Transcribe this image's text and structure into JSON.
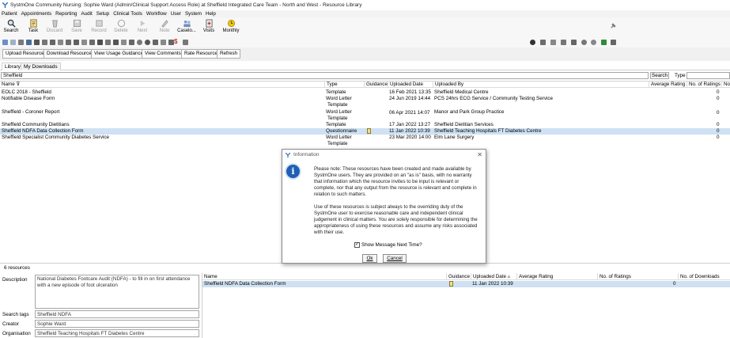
{
  "window": {
    "title": "SystmOne Community Nursing: Sophie Ward (Admin/Clinical Support Access Role) at Sheffield Integrated Care Team - North and West - Resource Library"
  },
  "menu": [
    "Patient",
    "Appointments",
    "Reporting",
    "Audit",
    "Setup",
    "Clinical Tools",
    "Workflow",
    "User",
    "System",
    "Help"
  ],
  "toolbar": [
    {
      "label": "Search",
      "icon": "search-icon",
      "enabled": true
    },
    {
      "label": "Task",
      "icon": "task-icon",
      "enabled": true
    },
    {
      "label": "Discard",
      "icon": "discard-icon",
      "enabled": false
    },
    {
      "label": "Save",
      "icon": "save-icon",
      "enabled": false
    },
    {
      "label": "Record",
      "icon": "record-icon",
      "enabled": false
    },
    {
      "label": "Delete",
      "icon": "delete-icon",
      "enabled": false
    },
    {
      "label": "Next",
      "icon": "next-icon",
      "enabled": false
    },
    {
      "label": "Note",
      "icon": "note-icon",
      "enabled": false
    },
    {
      "label": "Caselo...",
      "icon": "caseload-icon",
      "enabled": true
    },
    {
      "label": "Visits",
      "icon": "visits-icon",
      "enabled": true
    },
    {
      "label": "Monthly",
      "icon": "monthly-icon",
      "enabled": true
    }
  ],
  "actions": {
    "upload": "Upload Resource",
    "download": "Download Resource",
    "usage": "View Usage Guidance",
    "comments": "View Comments",
    "rate": "Rate Resource",
    "refresh": "Refresh"
  },
  "tabs": [
    "Library",
    "My Downloads"
  ],
  "search": {
    "value": "Sheffield",
    "button": "Search",
    "type_label": "Type"
  },
  "grid": {
    "columns": [
      "Name",
      "Type",
      "Guidance",
      "Uploaded Date",
      "Uploaded By",
      "Average Rating",
      "No. of Ratings",
      "No"
    ],
    "rows": [
      {
        "name": "EOLC 2018 - Sheffield",
        "type": "Template",
        "type2": "",
        "guidance": false,
        "date": "16 Feb 2021 13:35",
        "by": "Sheffield Medical Centre",
        "ratings": "0",
        "selected": false
      },
      {
        "name": "Notifiable Disease Form",
        "type": "Word Letter",
        "type2": "Template",
        "guidance": false,
        "date": "24 Jun 2019 14:44",
        "by": "PCS 24hrs ECG Service / Community Testing Service",
        "ratings": "0",
        "selected": false
      },
      {
        "name": "Sheffield - Coroner Report",
        "type": "Word Letter",
        "type2": "Template",
        "guidance": false,
        "date": "06 Apr 2021 14:07",
        "by": "Manor and Park Group Practice",
        "ratings": "0",
        "selected": false
      },
      {
        "name": "Sheffield Community Dietitians",
        "type": "Template",
        "type2": "",
        "guidance": false,
        "date": "17 Jan 2022 13:27",
        "by": "Sheffield Dietitian Services",
        "ratings": "0",
        "selected": false
      },
      {
        "name": "Sheffield NDFA Data Collection Form",
        "type": "Questionnaire",
        "type2": "",
        "guidance": true,
        "date": "11 Jan 2022 10:39",
        "by": "Sheffield Teaching Hospitals FT Diabetes Centre",
        "ratings": "0",
        "selected": true
      },
      {
        "name": "Sheffield Specialist Community Diabetes Service",
        "type": "Word Letter",
        "type2": "Template",
        "guidance": false,
        "date": "23 Mar 2020 14:00",
        "by": "Elm Lane Surgery",
        "ratings": "0",
        "selected": false
      }
    ]
  },
  "details": {
    "count": "6 resources",
    "description_label": "Description",
    "description": "National Diabetes Footcare Audit (NDFA) - to fill in on first attendance with a new episode of foot ulceration",
    "tags_label": "Search tags",
    "tags": "Sheffield NDFA",
    "creator_label": "Creator",
    "creator": "Sophie Ward",
    "org_label": "Organisation",
    "org": "Sheffield Teaching Hospitals FT Diabetes Centre"
  },
  "detail_grid": {
    "columns": [
      "Name",
      "Guidance",
      "Uploaded Date",
      "Average Rating",
      "No. of Ratings",
      "No. of Downloads"
    ],
    "row": {
      "name": "Sheffield NDFA Data Collection Form",
      "date": "11 Jan 2022 10:39",
      "ratings": "0"
    }
  },
  "dialog": {
    "title": "Information",
    "para1": "Please note: These resources have been created and made available by SystmOne users. They are provided on an \"as is\" basis, with no warranty that information which the resource invites to be input is relevant or complete, nor that any output from the resource is relevant and complete in relation to such matters.",
    "para2": "Use of these resources is subject always to the overriding duty of the SystmOne user to exercise reasonable care and independent clinical judgement in clinical matters. You are solely responsible for determining the appropriateness of using these resources and assume any risks associated with their use.",
    "checkbox": "Show Message Next Time?",
    "ok": "Ok",
    "cancel": "Cancel"
  },
  "colors": {
    "selection": "#cfe1f3",
    "info_blue": "#1f5fb4"
  }
}
